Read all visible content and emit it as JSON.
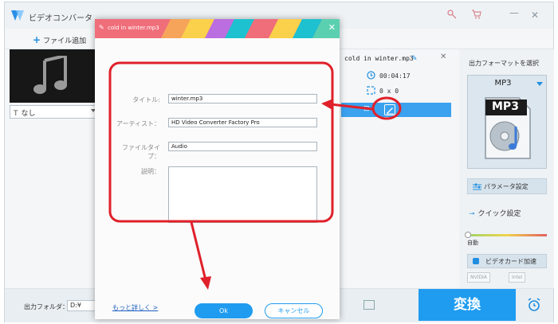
{
  "app": {
    "title": "ビデオコンバータ",
    "window_controls": [
      "key-icon",
      "cart-icon",
      "minimize-icon",
      "close-icon"
    ]
  },
  "toolbar": {
    "add_file_label": "ファイル追加"
  },
  "left": {
    "subtitle_value": "なし"
  },
  "file": {
    "name": "cold in winter.mp3",
    "duration": "00:04:17",
    "resolution": "0 x 0"
  },
  "output": {
    "label": "出力フォーマットを選択",
    "format": "MP3",
    "format_icon_text": "MP3",
    "param_button": "パラメータ設定",
    "quick_label": "クイック設定",
    "slider_label": "自動",
    "gpu_button": "ビデオカード加速",
    "gpu_chips": [
      "NVIDIA",
      "Intel"
    ]
  },
  "footer": {
    "folder_label": "出力フォルダ：",
    "folder_value": "D:¥",
    "convert_label": "変換"
  },
  "dialog": {
    "title": "cold in winter.mp3",
    "fields": {
      "title_label": "タイトル:",
      "title_value": "winter.mp3",
      "artist_label": "アーティスト：",
      "artist_value": "HD Video Converter Factory Pro",
      "filetype_label": "ファイルタイプ：",
      "filetype_value": "Audio",
      "desc_label": "説明："
    },
    "more_link": "もっと詳しく >",
    "ok_label": "Ok",
    "cancel_label": "キャンセル"
  },
  "colors": {
    "accent": "#1f9cf0",
    "dialog_header": "#f06d7a",
    "annotation_red": "#e0202a"
  }
}
